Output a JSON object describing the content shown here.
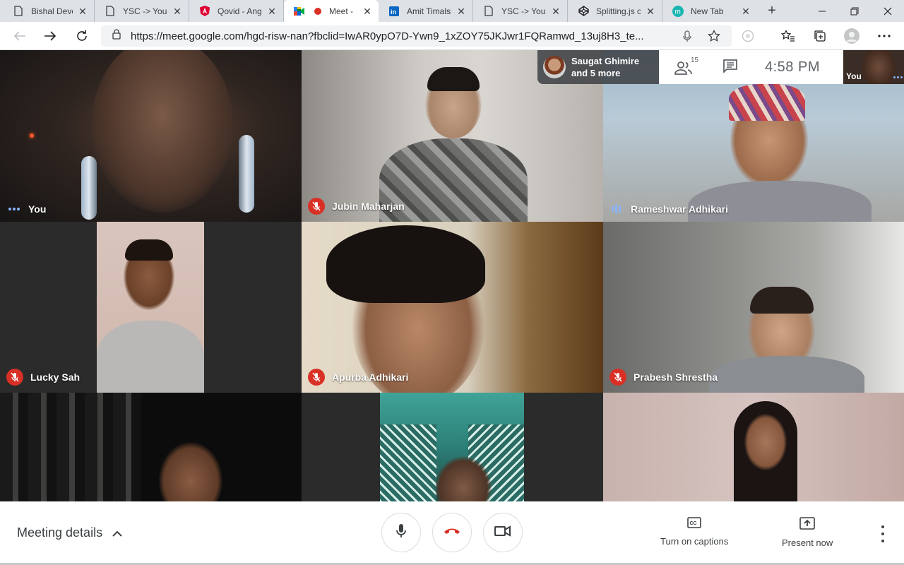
{
  "browser": {
    "tabs": [
      {
        "title": "Bishal Developer",
        "favicon": "document-icon"
      },
      {
        "title": "YSC -> Your Study",
        "favicon": "document-icon"
      },
      {
        "title": "Qovid - Angular",
        "favicon": "angular-icon"
      },
      {
        "title": "Meet -",
        "favicon": "google-meet-icon",
        "recording": true,
        "active": true
      },
      {
        "title": "Amit Timalsina",
        "favicon": "linkedin-icon"
      },
      {
        "title": "YSC -> Your Study",
        "favicon": "document-icon"
      },
      {
        "title": "Splitting.js on",
        "favicon": "codepen-icon"
      },
      {
        "title": "New Tab",
        "favicon": "edge-new-tab-icon"
      }
    ],
    "url": "https://meet.google.com/hgd-risw-nan?fbclid=IwAR0ypO7D-Ywn9_1xZOY75JKJwr1FQRamwd_13uj8H3_te..."
  },
  "meet": {
    "participants": [
      {
        "name": "You",
        "status": "speaking-dots"
      },
      {
        "name": "Jubin Maharjan",
        "status": "muted"
      },
      {
        "name": "Rameshwar Adhikari",
        "status": "speaking-bars"
      },
      {
        "name": "Lucky Sah",
        "status": "muted"
      },
      {
        "name": "Apurba Adhikari",
        "status": "muted"
      },
      {
        "name": "Prabesh Shrestha",
        "status": "muted"
      },
      {
        "name": "",
        "status": "none"
      },
      {
        "name": "",
        "status": "none"
      },
      {
        "name": "",
        "status": "none"
      }
    ],
    "overlay": {
      "presenter_line1": "Saugat Ghimire",
      "presenter_line2": "and 5 more",
      "people_count": "15",
      "time": "4:58  PM",
      "self_label": "You"
    },
    "bottom": {
      "meeting_details": "Meeting details",
      "captions_label": "Turn on captions",
      "present_label": "Present now"
    }
  },
  "colors": {
    "mute_red": "#d93025",
    "speaking_blue": "#8ab4f8",
    "hangup_red": "#d93025",
    "text_dark": "#3c4043"
  }
}
